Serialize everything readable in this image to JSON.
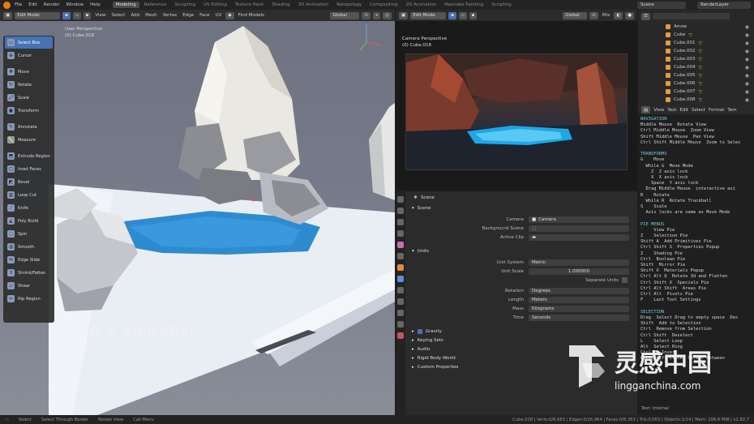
{
  "topbar": {
    "menus": [
      "File",
      "Edit",
      "Render",
      "Window",
      "Help"
    ],
    "workspaces": [
      "Modeling",
      "Reference",
      "Sculpting",
      "UV Editing",
      "Texture Paint",
      "Shading",
      "3D Animation",
      "Retopology",
      "Compositing",
      "2D Animation",
      "Masnake Painting",
      "Scripting"
    ],
    "active_workspace": "Modeling",
    "scene": "Scene",
    "view_layer": "RenderLayer"
  },
  "viewport": {
    "mode": "Edit Mode",
    "menus": [
      "View",
      "Select",
      "Add",
      "Mesh",
      "Vertex",
      "Edge",
      "Face",
      "UV"
    ],
    "find_models": "Find Models",
    "orientation": "Global",
    "perspective": "User Perspective",
    "object": "(0) Cube.018",
    "overlay_hint": "Ctrl + Spacebar",
    "tools": [
      "Select Box",
      "Cursor",
      "Move",
      "Rotate",
      "Scale",
      "Transform",
      "Annotate",
      "Measure",
      "Extrude Region",
      "Inset Faces",
      "Bevel",
      "Loop Cut",
      "Knife",
      "Poly Build",
      "Spin",
      "Smooth",
      "Edge Slide",
      "Shrink/Fatten",
      "Shear",
      "Rip Region"
    ]
  },
  "camera": {
    "mode": "Edit Mode",
    "orientation": "Global",
    "mix": "Mix",
    "perspective": "Camera Perspective",
    "object": "(0) Cube.018"
  },
  "properties": {
    "context": "Scene",
    "section_scene": "Scene",
    "camera_label": "Camera",
    "camera_value": "Camera",
    "bg_label": "Background Scene",
    "clip_label": "Active Clip",
    "section_units": "Units",
    "unit_system_label": "Unit System",
    "unit_system": "Metric",
    "unit_scale_label": "Unit Scale",
    "unit_scale": "1.000000",
    "separate_units": "Separate Units",
    "rotation_label": "Rotation",
    "rotation": "Degrees",
    "length_label": "Length",
    "length": "Meters",
    "mass_label": "Mass",
    "mass": "Kilograms",
    "time_label": "Time",
    "time": "Seconds",
    "sections": [
      "Gravity",
      "Keying Sets",
      "Audio",
      "Rigid Body World",
      "Custom Properties"
    ]
  },
  "outliner": {
    "items": [
      "Arrow",
      "Cube",
      "Cube.001",
      "Cube.002",
      "Cube.003",
      "Cube.004",
      "Cube.005",
      "Cube.006",
      "Cube.007",
      "Cube.008"
    ]
  },
  "texteditor": {
    "menus": [
      "View",
      "Text",
      "Edit",
      "Select",
      "Format",
      "Tem"
    ],
    "file": "Text: Internal",
    "lines": [
      "NAVIGATION",
      "Middle Mouse  Rotate View",
      "Ctrl Middle Mouse  Zoom View",
      "Shift Middle Mouse  Pan View",
      "Ctrl Shift Middle Mouse  Zoom to Selec",
      "",
      "TRANSFORMS",
      "G    Move",
      "  While G  Move Mode",
      "    Z  Z axis lock",
      "    X  X axis lock",
      "    Space  Y axis lock",
      "  Drag Middle Mouse  interactive axi",
      "R    Rotate",
      "  While R  Rotate Trackball",
      "S    Scale",
      "  Axis locks are same as Move Mode",
      "",
      "PIE MENUS",
      "`    View Pie",
      "Z    Selection Pie",
      "Shift A  Add Primitives Pie",
      "Ctrl Shift S  Properties Popup",
      "Z    Shading Pie",
      "Ctrl  Boolean Pie",
      "Shift  Mirror Pie",
      "Shift X  Materials Popup",
      "Ctrl Alt Q  Rotate 3d and Flatten",
      "Ctrl Shift X  Specials Pie",
      "Ctrl Alt Shift  Areas Pie",
      "Ctrl Alt  Pivots Pie",
      "F    Last Tool Settings",
      "",
      "SELECTION",
      "Drag  Select Drag to empty space  Des",
      "Shift  Add to Selection",
      "Ctrl  Remove from Selection",
      "Ctrl Shift  Deselect",
      "L    Select Loop",
      "Alt  Select Ring",
      "Ctrl I  Invert",
      "Ctrl Shift Click  Select Between"
    ]
  },
  "status": {
    "left": [
      "Select",
      "Select Through Border",
      "Rotate View",
      "Call Menu"
    ],
    "right": "Cube.018 | Verts:0/8,683 | Edges:0/16,964 | Faces:0/8,363 | Tris:0,563 | Objects:1/14 | Mem: 106.6 MiB | v2.82.7"
  },
  "colors": {
    "accent": "#4772b3",
    "orange": "#e87d0d",
    "water": "#2f8bd0"
  }
}
